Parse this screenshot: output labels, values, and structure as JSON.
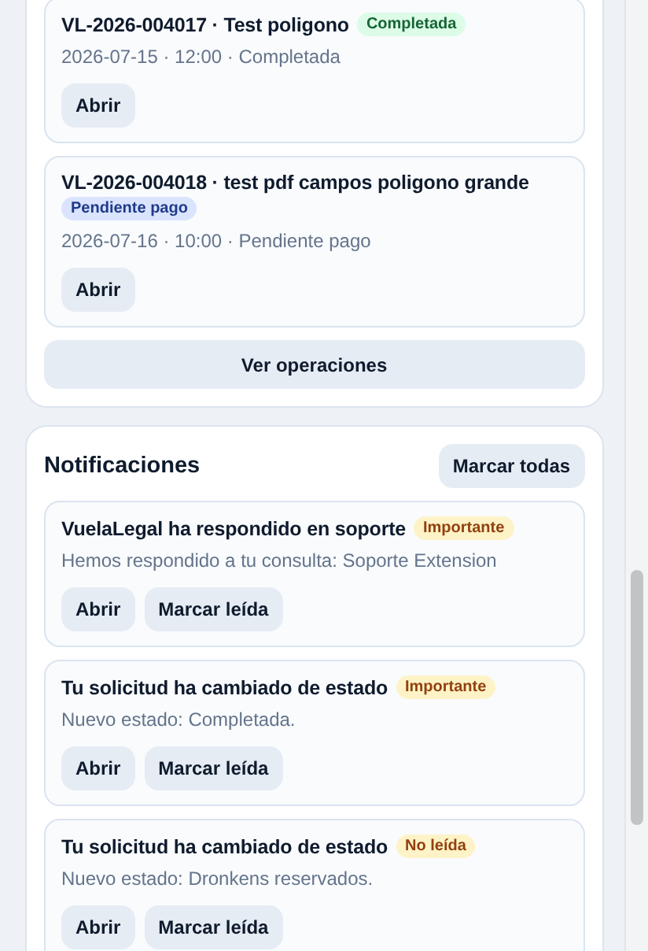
{
  "operations": {
    "items": [
      {
        "title": "VL-2026-004017 · Test poligono",
        "badge": {
          "label": "Completada",
          "kind": "success"
        },
        "meta": "2026-07-15 · 12:00 · Completada",
        "actions": [
          "Abrir"
        ]
      },
      {
        "title": "VL-2026-004018 · test pdf campos poligono grande",
        "badge": {
          "label": "Pendiente pago",
          "kind": "info"
        },
        "meta": "2026-07-16 · 10:00 · Pendiente pago",
        "actions": [
          "Abrir"
        ]
      }
    ],
    "footer_button": "Ver operaciones"
  },
  "notifications": {
    "title": "Notificaciones",
    "header_button": "Marcar todas",
    "items": [
      {
        "title": "VuelaLegal ha respondido en soporte",
        "badge": {
          "label": "Importante",
          "kind": "warning"
        },
        "body": "Hemos respondido a tu consulta: Soporte Extension",
        "actions": [
          "Abrir",
          "Marcar leída"
        ]
      },
      {
        "title": "Tu solicitud ha cambiado de estado",
        "badge": {
          "label": "Importante",
          "kind": "warning"
        },
        "body": "Nuevo estado: Completada.",
        "actions": [
          "Abrir",
          "Marcar leída"
        ]
      },
      {
        "title": "Tu solicitud ha cambiado de estado",
        "badge": {
          "label": "No leída",
          "kind": "warning"
        },
        "body": "Nuevo estado: Dronkens reservados.",
        "actions": [
          "Abrir",
          "Marcar leída"
        ]
      }
    ]
  }
}
